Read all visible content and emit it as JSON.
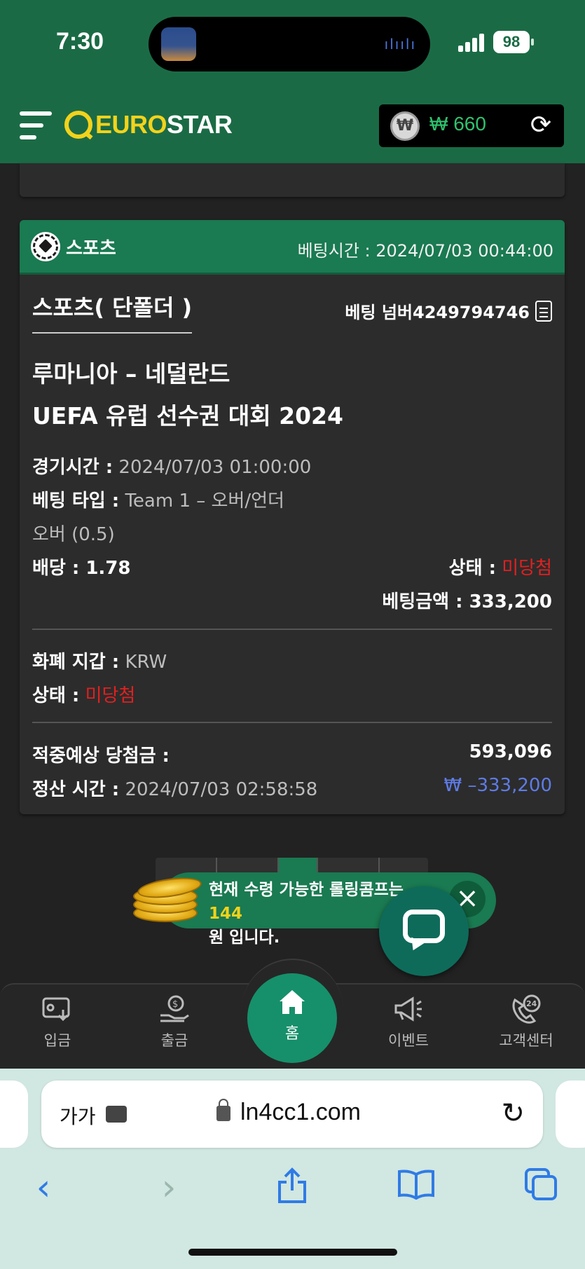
{
  "status_bar": {
    "time": "7:30",
    "battery": "98"
  },
  "header": {
    "logo_euro": "EURO",
    "logo_star": "STAR",
    "wallet_amount": "₩ 660",
    "wallet_currency_symbol": "₩"
  },
  "bet": {
    "category": "스포츠",
    "bet_time_label": "베팅시간 : 2024/07/03 00:44:00",
    "type_title": "스포츠( 단폴더 )",
    "bet_number": "베팅 넘버4249794746",
    "match_teams": "루마니아 – 네덜란드",
    "league": "UEFA 유럽 선수권 대회 2024",
    "game_time_label": "경기시간 :",
    "game_time_value": "2024/07/03 01:00:00",
    "bet_type_label": "베팅 타입 :",
    "bet_type_value": "Team 1 – 오버/언더",
    "bet_pick": "오버 (0.5)",
    "odds_label": "배당 : 1.78",
    "status_label": "상태 :",
    "status_value": "미당첨",
    "bet_amount_label": "베팅금액 : 333,200",
    "wallet_label": "화폐 지갑 :",
    "wallet_value": "KRW",
    "status2_label": "상태 :",
    "status2_value": "미당첨",
    "expected_win_label": "적중예상 당첨금 :",
    "expected_win_value": "593,096",
    "settle_label": "정산 시간 :",
    "settle_value": "2024/07/03 02:58:58",
    "settle_amount": "₩ –333,200"
  },
  "toast": {
    "line1": "현재 수령 가능한 롤링콤프는 ",
    "highlight": "144",
    "line2": "원 입니다."
  },
  "nav": {
    "deposit": "입금",
    "withdraw": "출금",
    "home": "홈",
    "event": "이벤트",
    "support": "고객센터"
  },
  "browser": {
    "text_size": "가가",
    "domain": "ln4cc1.com"
  },
  "colors": {
    "brand_green": "#1a6b45",
    "accent_yellow": "#f2d21c",
    "loss_red": "#e22020",
    "amount_blue": "#5e7be6"
  }
}
